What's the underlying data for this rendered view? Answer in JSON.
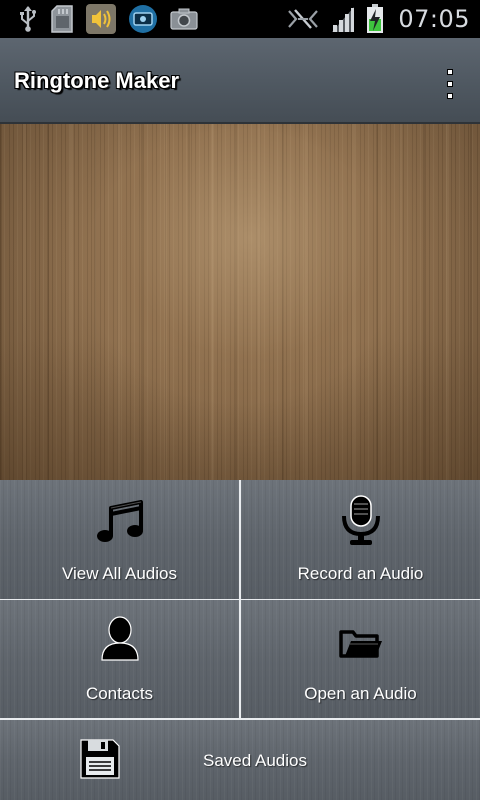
{
  "status_bar": {
    "time": "07:05",
    "left_icons": [
      "usb-icon",
      "sd-card-icon",
      "volume-icon",
      "video-icon",
      "camera-icon"
    ],
    "right_icons": [
      "no-signal-data-icon",
      "signal-icon",
      "battery-charging-icon"
    ]
  },
  "action_bar": {
    "title": "Ringtone Maker",
    "overflow_icon": "overflow-menu-icon"
  },
  "menu": {
    "view_all": {
      "label": "View All Audios",
      "icon": "music-note-icon"
    },
    "record": {
      "label": "Record an Audio",
      "icon": "microphone-icon"
    },
    "contacts": {
      "label": "Contacts",
      "icon": "contact-person-icon"
    },
    "open": {
      "label": "Open an Audio",
      "icon": "folder-open-icon"
    },
    "saved": {
      "label": "Saved Audios",
      "icon": "floppy-disk-icon"
    }
  },
  "colors": {
    "status_bar_bg": "#000000",
    "action_bar_bg": "#4f5861",
    "wood": "#8a6c4c",
    "tile_bg": "#5f656c",
    "divider": "#e9ecef",
    "battery_green": "#3ec43e"
  }
}
